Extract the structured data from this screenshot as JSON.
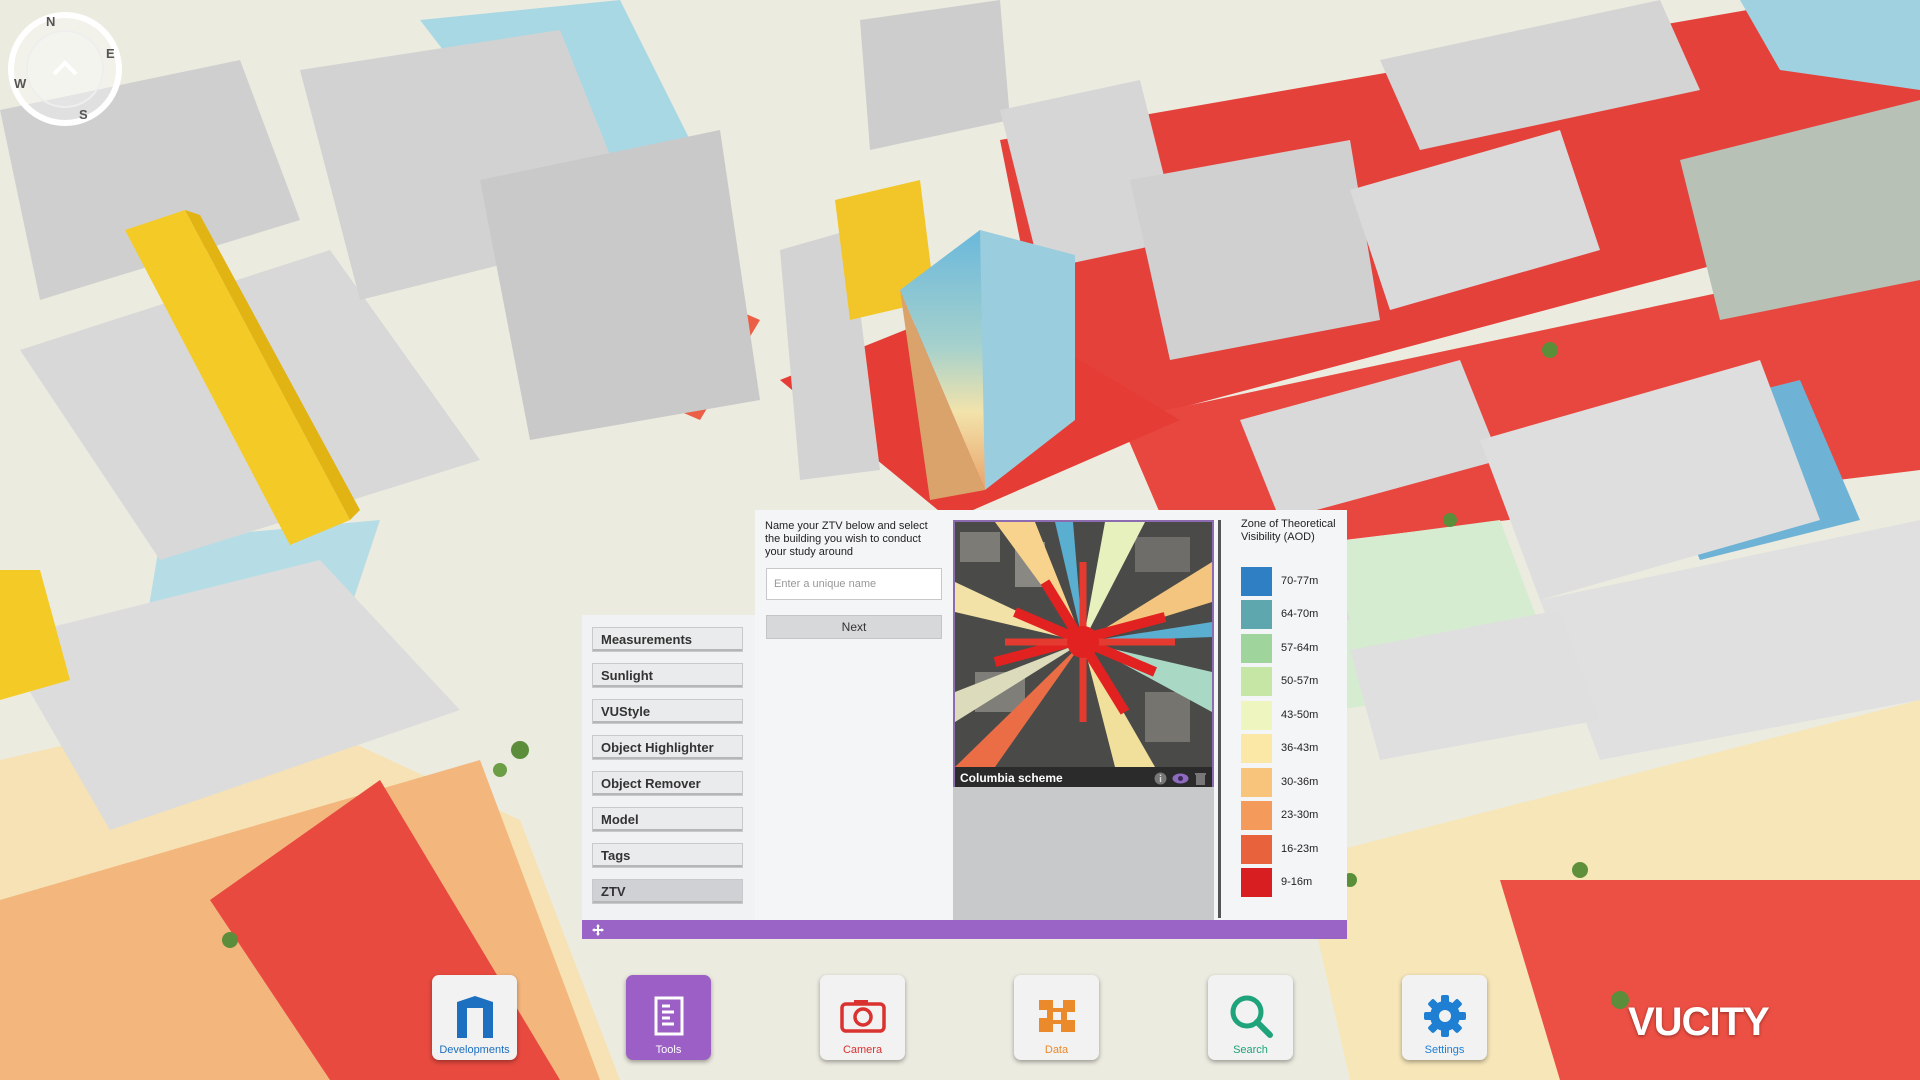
{
  "compass": {
    "n": "N",
    "e": "E",
    "s": "S",
    "w": "W"
  },
  "tools": {
    "items": [
      {
        "label": "Measurements"
      },
      {
        "label": "Sunlight"
      },
      {
        "label": "VUStyle"
      },
      {
        "label": "Object Highlighter"
      },
      {
        "label": "Object Remover"
      },
      {
        "label": "Model"
      },
      {
        "label": "Tags"
      },
      {
        "label": "ZTV"
      }
    ],
    "active": "ZTV"
  },
  "ztv": {
    "instructions": "Name your ZTV below and select the building you wish to conduct your study around",
    "name_placeholder": "Enter a unique name",
    "next_label": "Next",
    "scheme_name": "Columbia scheme",
    "legend_title": "Zone of Theoretical Visibility (AOD)",
    "legend": [
      {
        "label": "70-77m",
        "color": "#2e7fc4"
      },
      {
        "label": "64-70m",
        "color": "#5fa7ae"
      },
      {
        "label": "57-64m",
        "color": "#9fd49d"
      },
      {
        "label": "50-57m",
        "color": "#c6e6a6"
      },
      {
        "label": "43-50m",
        "color": "#eef5bf"
      },
      {
        "label": "36-43m",
        "color": "#fbe7a6"
      },
      {
        "label": "30-36m",
        "color": "#f8c47c"
      },
      {
        "label": "23-30m",
        "color": "#f49a5a"
      },
      {
        "label": "16-23m",
        "color": "#e8623b"
      },
      {
        "label": "9-16m",
        "color": "#d81e21"
      }
    ]
  },
  "dock": {
    "items": [
      {
        "label": "Developments",
        "icon": "developments-icon",
        "color": "#1d6fc0"
      },
      {
        "label": "Tools",
        "icon": "tools-icon",
        "color": "#ffffff"
      },
      {
        "label": "Camera",
        "icon": "camera-icon",
        "color": "#d9322f"
      },
      {
        "label": "Data",
        "icon": "data-icon",
        "color": "#ea8a2a"
      },
      {
        "label": "Search",
        "icon": "search-icon",
        "color": "#1fa37a"
      },
      {
        "label": "Settings",
        "icon": "settings-icon",
        "color": "#1e7fd3"
      }
    ]
  },
  "logo": "VUCITY"
}
